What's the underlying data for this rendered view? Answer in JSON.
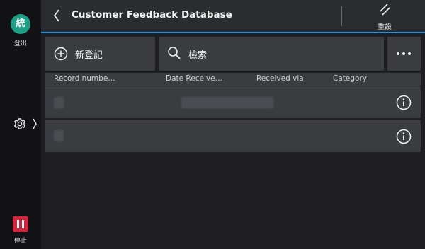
{
  "rail": {
    "user": {
      "initial": "統",
      "label": "登出"
    },
    "stop": {
      "label": "停止"
    },
    "stop_color": "#d2263f",
    "user_color": "#1f9e86"
  },
  "header": {
    "title": "Customer Feedback Database",
    "reset_label": "重設",
    "accent_color": "#2d8fd6"
  },
  "toolbar": {
    "new_label": "新登記",
    "search_label": "檢索"
  },
  "table": {
    "columns": [
      "Record numbe…",
      "Date Receive…",
      "Received via",
      "Category"
    ],
    "rows": [
      {
        "content": "redacted"
      },
      {
        "content": "redacted"
      }
    ]
  }
}
